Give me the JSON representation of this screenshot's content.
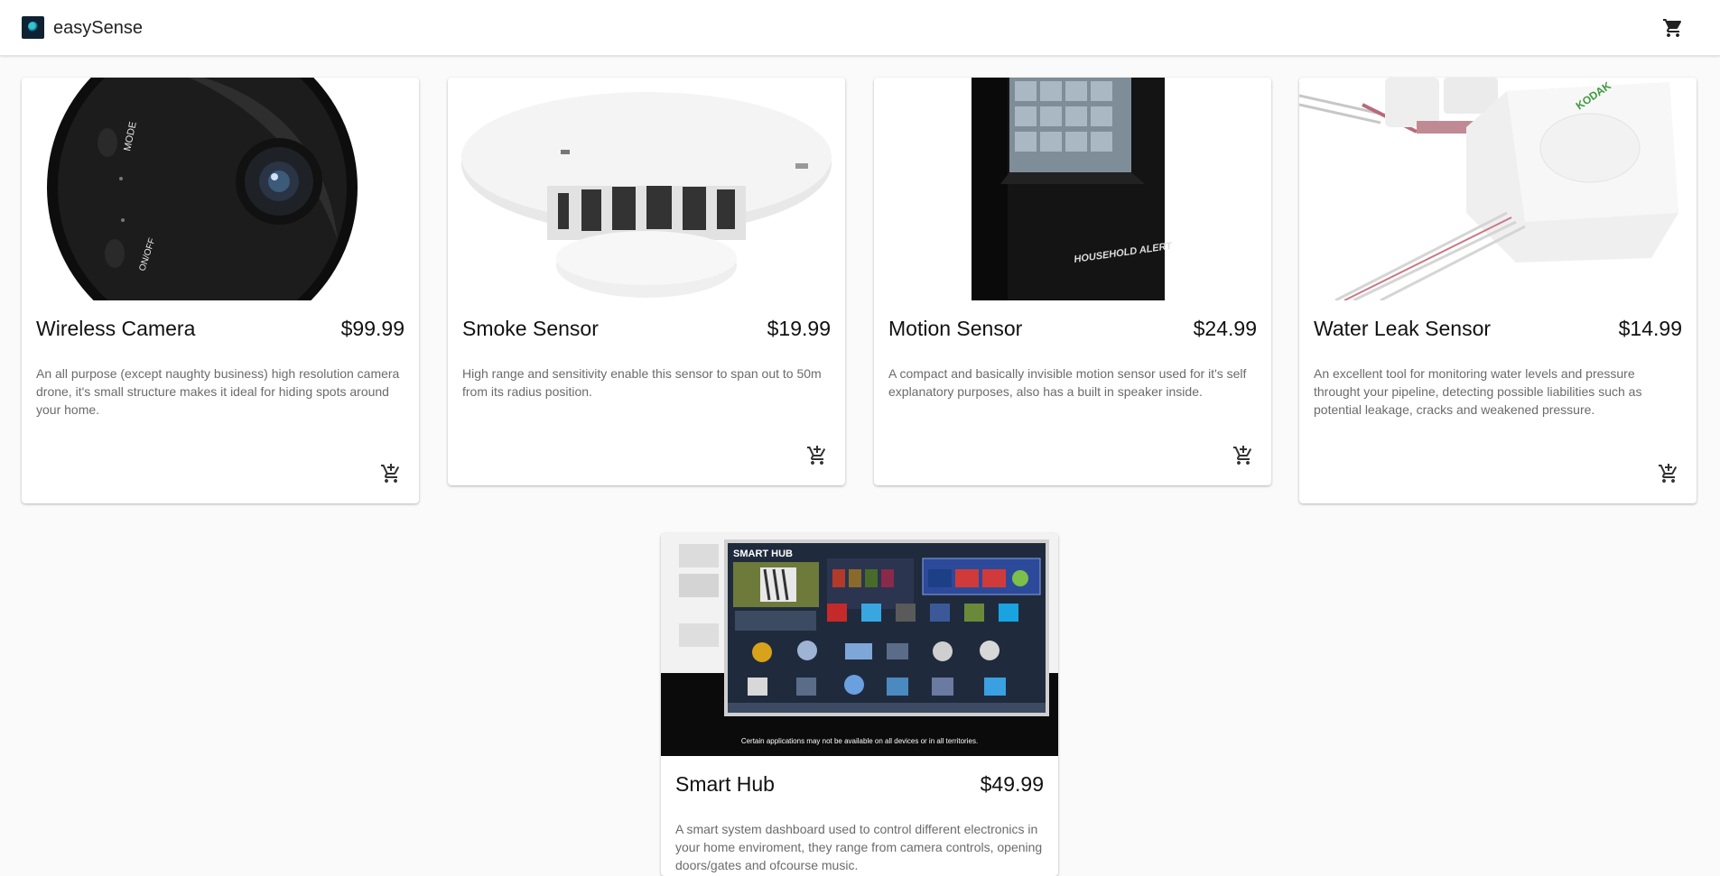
{
  "app": {
    "brand": "easySense",
    "logo_icon": "easysense-logo-icon",
    "cart_icon": "shopping-cart-icon"
  },
  "products": [
    {
      "name": "Wireless Camera",
      "price": "$99.99",
      "description": "An all purpose (except naughty business) high resolution camera drone, it's small structure makes it ideal for hiding spots around your home.",
      "image": "wireless-camera-photo",
      "action_icon": "add-shopping-cart-icon"
    },
    {
      "name": "Smoke Sensor",
      "price": "$19.99",
      "description": "High range and sensitivity enable this sensor to span out to 50m from its radius position.",
      "image": "smoke-sensor-photo",
      "action_icon": "add-shopping-cart-icon"
    },
    {
      "name": "Motion Sensor",
      "price": "$24.99",
      "description": "A compact and basically invisible motion sensor used for it's self explanatory purposes, also has a built in speaker inside.",
      "image": "motion-sensor-photo",
      "action_icon": "add-shopping-cart-icon"
    },
    {
      "name": "Water Leak Sensor",
      "price": "$14.99",
      "description": "An excellent tool for monitoring water levels and pressure throught your pipeline, detecting possible liabilities such as potential leakage, cracks and weakened pressure.",
      "image": "water-leak-sensor-photo",
      "action_icon": "add-shopping-cart-icon"
    },
    {
      "name": "Smart Hub",
      "price": "$49.99",
      "description": "A smart system dashboard used to control different electronics in your home enviroment, they range from camera controls, opening doors/gates and ofcourse music.",
      "image": "smart-hub-photo",
      "action_icon": "add-shopping-cart-icon"
    }
  ],
  "image_text": {
    "camera_mode": "MODE",
    "camera_onoff": "ON/OFF",
    "motion_brand": "HOUSEHOLD ALERT",
    "leak_brand": "KODAK",
    "hub_title": "SMART HUB",
    "hub_footer": "Certain applications may not be available on all devices or in all territories."
  }
}
